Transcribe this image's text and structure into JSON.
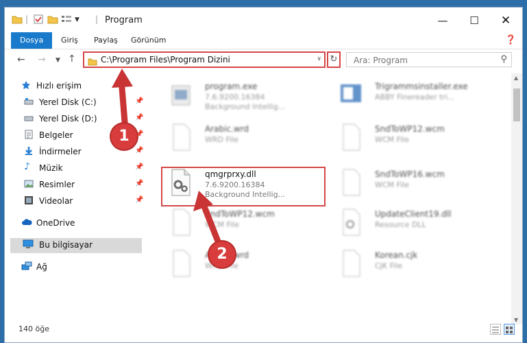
{
  "window": {
    "title": "Program"
  },
  "ribbon": {
    "tabs": [
      "Dosya",
      "Giriş",
      "Paylaş",
      "Görünüm"
    ]
  },
  "address": {
    "path": "C:\\Program Files\\Program Dizini"
  },
  "search": {
    "placeholder": "Ara: Program"
  },
  "sidebar": {
    "quick_access": "Hızlı erişim",
    "items": [
      {
        "label": "Yerel Disk (C:)",
        "icon": "drive-icon"
      },
      {
        "label": "Yerel Disk (D:)",
        "icon": "drive-icon"
      },
      {
        "label": "Belgeler",
        "icon": "documents-icon"
      },
      {
        "label": "İndirmeler",
        "icon": "download-icon"
      },
      {
        "label": "Müzik",
        "icon": "music-icon"
      },
      {
        "label": "Resimler",
        "icon": "pictures-icon"
      },
      {
        "label": "Videolar",
        "icon": "videos-icon"
      }
    ],
    "onedrive": "OneDrive",
    "this_pc": "Bu bilgisayar",
    "network": "Ağ"
  },
  "files": [
    {
      "name": "program.exe",
      "line1": "7.6.9200.16384",
      "line2": "Background Intellig..."
    },
    {
      "name": "Trigrammsinstaller.exe",
      "line1": "ABBY Finereader tri..."
    },
    {
      "name": "Arabic.wrd",
      "line1": "WRD File"
    },
    {
      "name": "SndToWP12.wcm",
      "line1": "WCM File"
    },
    {
      "name": "qmgrprxy.dll",
      "line1": "7.6.9200.16384",
      "line2": "Background Intellig..."
    },
    {
      "name": "SndToWP16.wcm",
      "line1": "WCM File"
    },
    {
      "name": "SndToWP12.wcm",
      "line1": "WCM File"
    },
    {
      "name": "UpdateClient19.dll",
      "line1": "Resource DLL"
    },
    {
      "name": "Arabic.wrd",
      "line1": "WRD File"
    },
    {
      "name": "Korean.cjk",
      "line1": "CJK File"
    }
  ],
  "status": {
    "count": "140 öğe"
  },
  "markers": [
    "1",
    "2"
  ],
  "colors": {
    "accent": "#1979ca",
    "highlight": "#d64545"
  }
}
